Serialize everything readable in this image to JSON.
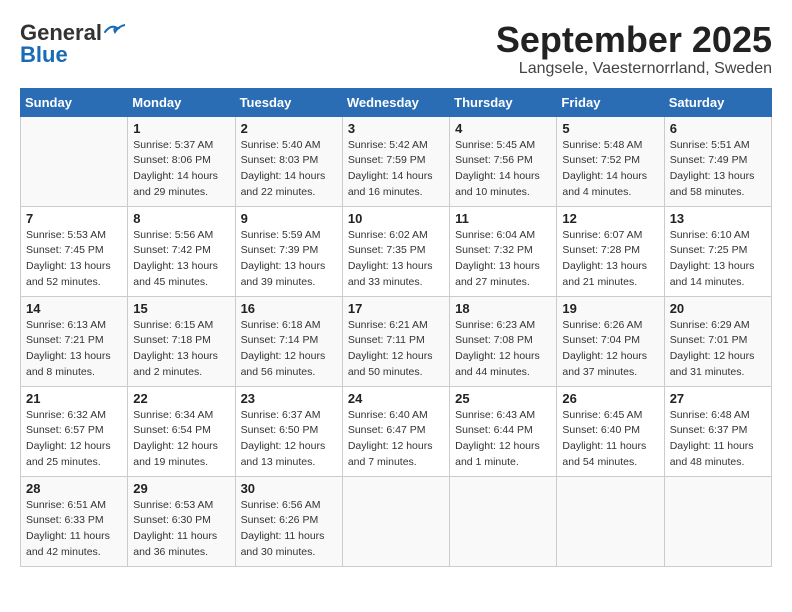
{
  "header": {
    "logo_general": "General",
    "logo_blue": "Blue",
    "title": "September 2025",
    "location": "Langsele, Vaesternorrland, Sweden"
  },
  "days_of_week": [
    "Sunday",
    "Monday",
    "Tuesday",
    "Wednesday",
    "Thursday",
    "Friday",
    "Saturday"
  ],
  "weeks": [
    [
      {
        "day": "",
        "info": ""
      },
      {
        "day": "1",
        "info": "Sunrise: 5:37 AM\nSunset: 8:06 PM\nDaylight: 14 hours\nand 29 minutes."
      },
      {
        "day": "2",
        "info": "Sunrise: 5:40 AM\nSunset: 8:03 PM\nDaylight: 14 hours\nand 22 minutes."
      },
      {
        "day": "3",
        "info": "Sunrise: 5:42 AM\nSunset: 7:59 PM\nDaylight: 14 hours\nand 16 minutes."
      },
      {
        "day": "4",
        "info": "Sunrise: 5:45 AM\nSunset: 7:56 PM\nDaylight: 14 hours\nand 10 minutes."
      },
      {
        "day": "5",
        "info": "Sunrise: 5:48 AM\nSunset: 7:52 PM\nDaylight: 14 hours\nand 4 minutes."
      },
      {
        "day": "6",
        "info": "Sunrise: 5:51 AM\nSunset: 7:49 PM\nDaylight: 13 hours\nand 58 minutes."
      }
    ],
    [
      {
        "day": "7",
        "info": "Sunrise: 5:53 AM\nSunset: 7:45 PM\nDaylight: 13 hours\nand 52 minutes."
      },
      {
        "day": "8",
        "info": "Sunrise: 5:56 AM\nSunset: 7:42 PM\nDaylight: 13 hours\nand 45 minutes."
      },
      {
        "day": "9",
        "info": "Sunrise: 5:59 AM\nSunset: 7:39 PM\nDaylight: 13 hours\nand 39 minutes."
      },
      {
        "day": "10",
        "info": "Sunrise: 6:02 AM\nSunset: 7:35 PM\nDaylight: 13 hours\nand 33 minutes."
      },
      {
        "day": "11",
        "info": "Sunrise: 6:04 AM\nSunset: 7:32 PM\nDaylight: 13 hours\nand 27 minutes."
      },
      {
        "day": "12",
        "info": "Sunrise: 6:07 AM\nSunset: 7:28 PM\nDaylight: 13 hours\nand 21 minutes."
      },
      {
        "day": "13",
        "info": "Sunrise: 6:10 AM\nSunset: 7:25 PM\nDaylight: 13 hours\nand 14 minutes."
      }
    ],
    [
      {
        "day": "14",
        "info": "Sunrise: 6:13 AM\nSunset: 7:21 PM\nDaylight: 13 hours\nand 8 minutes."
      },
      {
        "day": "15",
        "info": "Sunrise: 6:15 AM\nSunset: 7:18 PM\nDaylight: 13 hours\nand 2 minutes."
      },
      {
        "day": "16",
        "info": "Sunrise: 6:18 AM\nSunset: 7:14 PM\nDaylight: 12 hours\nand 56 minutes."
      },
      {
        "day": "17",
        "info": "Sunrise: 6:21 AM\nSunset: 7:11 PM\nDaylight: 12 hours\nand 50 minutes."
      },
      {
        "day": "18",
        "info": "Sunrise: 6:23 AM\nSunset: 7:08 PM\nDaylight: 12 hours\nand 44 minutes."
      },
      {
        "day": "19",
        "info": "Sunrise: 6:26 AM\nSunset: 7:04 PM\nDaylight: 12 hours\nand 37 minutes."
      },
      {
        "day": "20",
        "info": "Sunrise: 6:29 AM\nSunset: 7:01 PM\nDaylight: 12 hours\nand 31 minutes."
      }
    ],
    [
      {
        "day": "21",
        "info": "Sunrise: 6:32 AM\nSunset: 6:57 PM\nDaylight: 12 hours\nand 25 minutes."
      },
      {
        "day": "22",
        "info": "Sunrise: 6:34 AM\nSunset: 6:54 PM\nDaylight: 12 hours\nand 19 minutes."
      },
      {
        "day": "23",
        "info": "Sunrise: 6:37 AM\nSunset: 6:50 PM\nDaylight: 12 hours\nand 13 minutes."
      },
      {
        "day": "24",
        "info": "Sunrise: 6:40 AM\nSunset: 6:47 PM\nDaylight: 12 hours\nand 7 minutes."
      },
      {
        "day": "25",
        "info": "Sunrise: 6:43 AM\nSunset: 6:44 PM\nDaylight: 12 hours\nand 1 minute."
      },
      {
        "day": "26",
        "info": "Sunrise: 6:45 AM\nSunset: 6:40 PM\nDaylight: 11 hours\nand 54 minutes."
      },
      {
        "day": "27",
        "info": "Sunrise: 6:48 AM\nSunset: 6:37 PM\nDaylight: 11 hours\nand 48 minutes."
      }
    ],
    [
      {
        "day": "28",
        "info": "Sunrise: 6:51 AM\nSunset: 6:33 PM\nDaylight: 11 hours\nand 42 minutes."
      },
      {
        "day": "29",
        "info": "Sunrise: 6:53 AM\nSunset: 6:30 PM\nDaylight: 11 hours\nand 36 minutes."
      },
      {
        "day": "30",
        "info": "Sunrise: 6:56 AM\nSunset: 6:26 PM\nDaylight: 11 hours\nand 30 minutes."
      },
      {
        "day": "",
        "info": ""
      },
      {
        "day": "",
        "info": ""
      },
      {
        "day": "",
        "info": ""
      },
      {
        "day": "",
        "info": ""
      }
    ]
  ]
}
